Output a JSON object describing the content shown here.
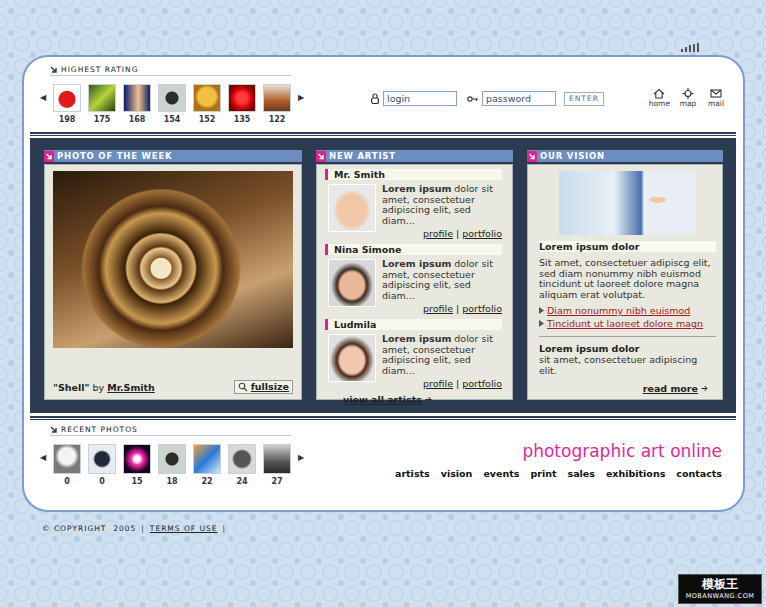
{
  "highest_rating": {
    "title": "HIGHEST RATING",
    "prev": "◀",
    "next": "▶",
    "thumbs": [
      {
        "count": "198"
      },
      {
        "count": "175"
      },
      {
        "count": "168"
      },
      {
        "count": "154"
      },
      {
        "count": "152"
      },
      {
        "count": "135"
      },
      {
        "count": "122"
      }
    ]
  },
  "login": {
    "login_placeholder": "login",
    "password_placeholder": "password",
    "button": "ENTER"
  },
  "top_nav": [
    {
      "label": "home"
    },
    {
      "label": "map"
    },
    {
      "label": "mail"
    }
  ],
  "photo_of_the_week": {
    "title": "PHOTO OF THE WEEK",
    "caption": {
      "name": "\"Shell\"",
      "by": "by",
      "author": "Mr.Smith"
    },
    "fullsize": "fullsize"
  },
  "new_artist": {
    "title": "NEW ARTIST",
    "artists": [
      {
        "name": "Mr. Smith",
        "lead": "Lorem ipsum",
        "text": "dolor sit amet, consectetuer adipiscing elit, sed diam...",
        "profile": "profile",
        "separator": "|",
        "portfolio": "portfolio"
      },
      {
        "name": "Nina Simone",
        "lead": "Lorem ipsum",
        "text": "dolor sit amet, consectetuer adipiscing elit, sed diam...",
        "profile": "profile",
        "separator": "|",
        "portfolio": "portfolio"
      },
      {
        "name": "Ludmila",
        "lead": "Lorem ipsum",
        "text": "dolor sit amet, consectetuer adipiscing elit, sed diam...",
        "profile": "profile",
        "separator": "|",
        "portfolio": "portfolio"
      }
    ],
    "view_all": "view all artists"
  },
  "our_vision": {
    "title": "OUR VISION",
    "heading": "Lorem ipsum dolor",
    "text": "Sit amet, consectetuer adipiscg elit, sed diam nonummy nibh euismod tincidunt ut laoreet dolore magna aliquam erat volutpat.",
    "links": [
      {
        "label": "Diam nonummy nibh euismod"
      },
      {
        "label": "Tincidunt ut laoreet dolore magn"
      }
    ],
    "subheading": "Lorem ipsum dolor",
    "subtext": "sit amet, consectetuer adipiscing elit.",
    "read_more": "read more"
  },
  "recent_photos": {
    "title": "RECENT PHOTOS",
    "prev": "◀",
    "next": "▶",
    "thumbs": [
      {
        "count": "0"
      },
      {
        "count": "0"
      },
      {
        "count": "15"
      },
      {
        "count": "18"
      },
      {
        "count": "22"
      },
      {
        "count": "24"
      },
      {
        "count": "27"
      }
    ]
  },
  "site_title": "photographic art online",
  "nav": [
    {
      "label": "artists"
    },
    {
      "label": "vision"
    },
    {
      "label": "events"
    },
    {
      "label": "print"
    },
    {
      "label": "sales"
    },
    {
      "label": "exhibitions"
    },
    {
      "label": "contacts"
    }
  ],
  "footer": {
    "copyright": "© COPYRIGHT  2005",
    "separator": "|",
    "terms": "TERMS OF USE"
  },
  "watermark": {
    "name": "模板王",
    "url": "MOBANWANG.COM"
  }
}
